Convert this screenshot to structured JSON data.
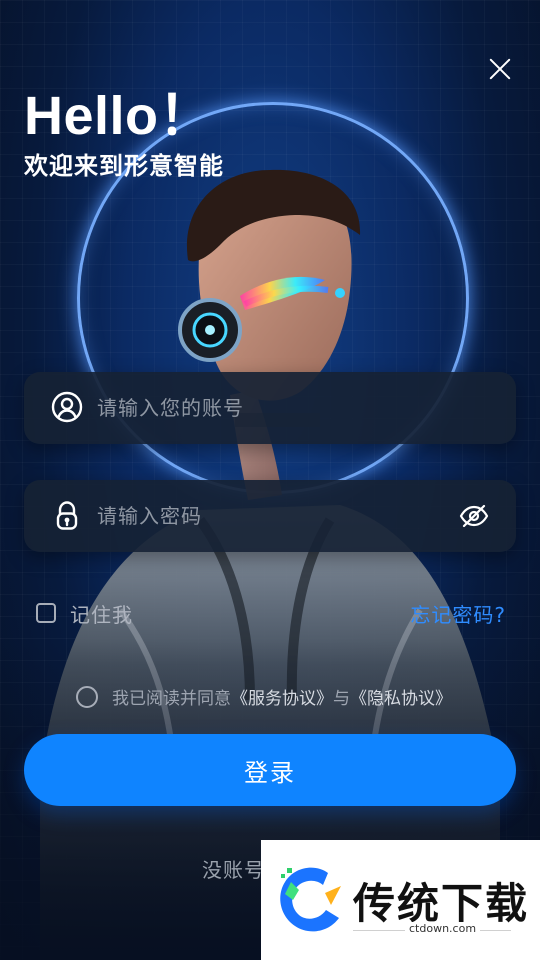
{
  "header": {
    "hello": "Hello！",
    "welcome": "欢迎来到形意智能"
  },
  "form": {
    "account_placeholder": "请输入您的账号",
    "password_placeholder": "请输入密码"
  },
  "options": {
    "remember_label": "记住我",
    "forgot_label": "忘记密码?"
  },
  "agreement": {
    "prefix": "我已阅读并同意",
    "service": "《服务协议》",
    "and": "与",
    "privacy": "《隐私协议》"
  },
  "actions": {
    "login_label": "登录",
    "register_label": "没账号"
  },
  "watermark": {
    "title": "传统下载",
    "url": "ctdown.com"
  },
  "colors": {
    "accent": "#0f84ff",
    "link": "#2f8cff",
    "ring": "#78afff"
  },
  "icons": {
    "close": "close-icon",
    "account": "user-circle-icon",
    "password": "lock-icon",
    "toggle_password": "eye-off-icon"
  }
}
